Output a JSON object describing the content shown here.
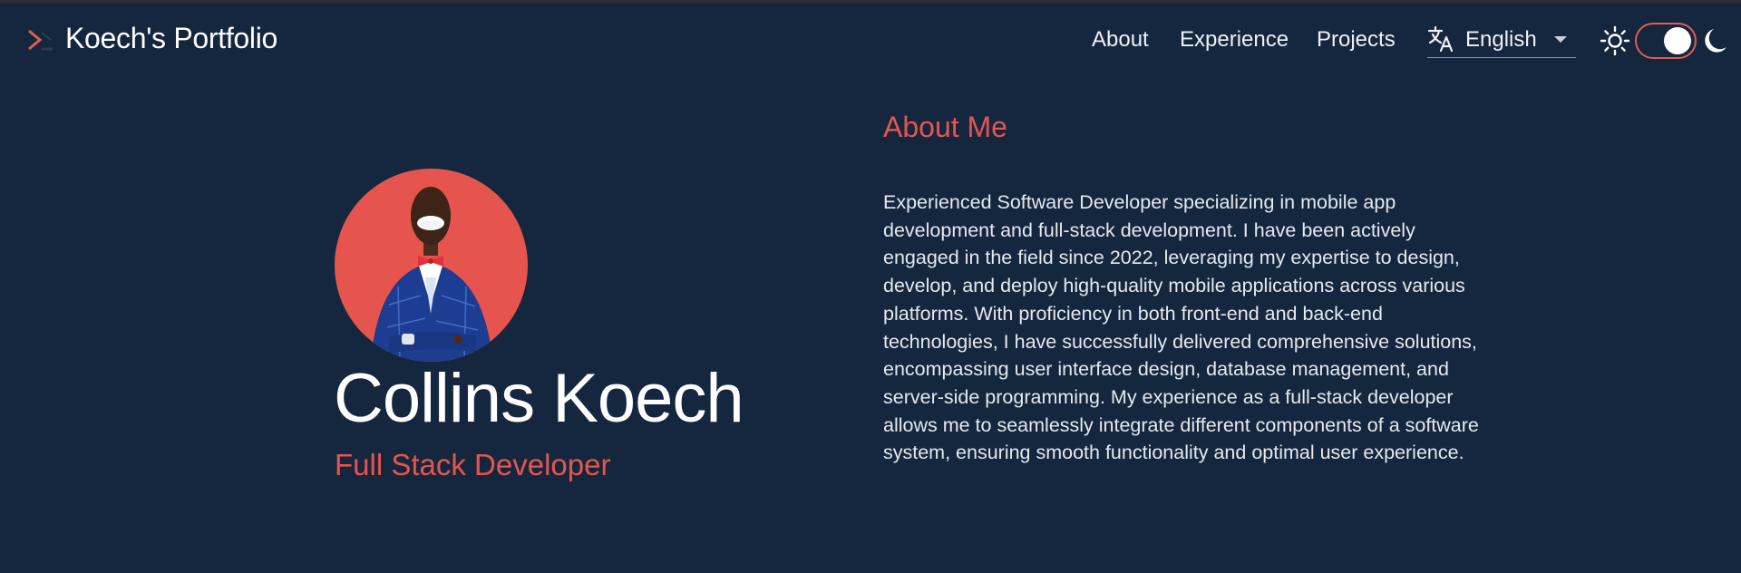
{
  "header": {
    "brand": "Koech's Portfolio",
    "nav": [
      {
        "label": "About"
      },
      {
        "label": "Experience"
      },
      {
        "label": "Projects"
      }
    ],
    "language": {
      "selected": "English",
      "icon": "translate-icon"
    },
    "theme_toggle": {
      "sun_icon": "sun-icon",
      "moon_icon": "moon-icon",
      "state": "dark"
    }
  },
  "profile": {
    "name": "Collins Koech",
    "role": "Full Stack Developer",
    "avatar_icon": "profile-photo"
  },
  "about": {
    "heading": "About Me",
    "body": "Experienced Software Developer specializing in mobile app development and full-stack development. I have been actively engaged in the field since 2022, leveraging my expertise to design, develop, and deploy high-quality mobile applications across various platforms. With proficiency in both front-end and back-end technologies, I have successfully delivered comprehensive solutions, encompassing user interface design, database management, and server-side programming. My experience as a full-stack developer allows me to seamlessly integrate different components of a software system, ensuring smooth functionality and optimal user experience."
  },
  "colors": {
    "background": "#15273f",
    "accent": "#e6554d",
    "text": "#ffffff"
  }
}
